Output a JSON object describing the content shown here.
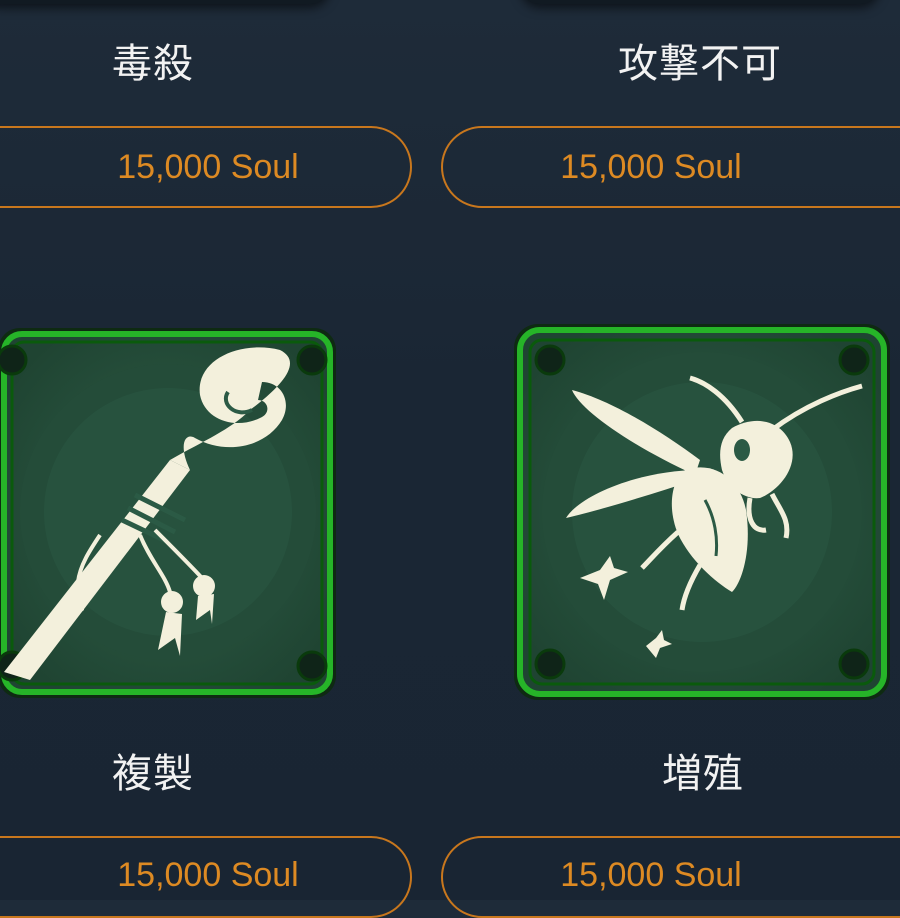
{
  "skills": [
    {
      "name": "毒殺",
      "price": "15,000 Soul",
      "icon": "poison-kill-icon"
    },
    {
      "name": "攻撃不可",
      "price": "15,000 Soul",
      "icon": "attack-disabled-icon"
    },
    {
      "name": "複製",
      "price": "15,000 Soul",
      "icon": "staff-icon"
    },
    {
      "name": "増殖",
      "price": "15,000 Soul",
      "icon": "wasp-icon"
    }
  ],
  "colors": {
    "background": "#1b2735",
    "accent_orange": "#dd8a23",
    "frame_green": "#22b524",
    "icon_bg": "#2b5a45",
    "icon_glyph": "#f3f0dc"
  }
}
